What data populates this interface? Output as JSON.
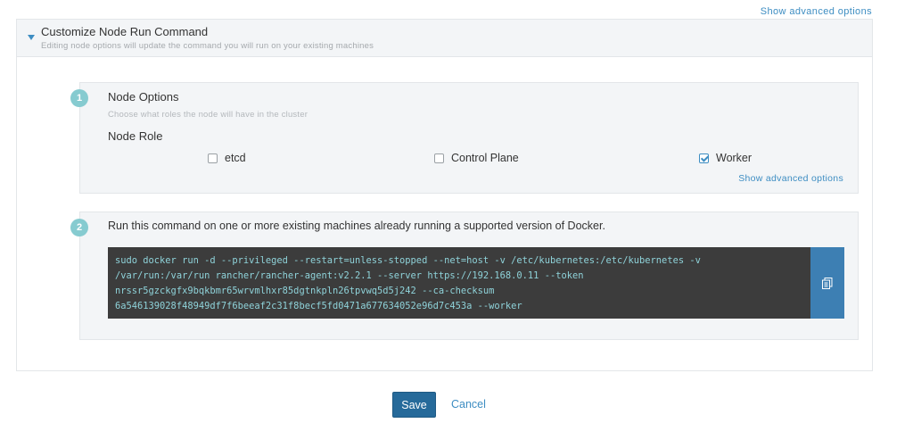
{
  "header": {
    "advanced_link": "Show advanced options"
  },
  "panel": {
    "title": "Customize Node Run Command",
    "subtitle": "Editing node options will update the command you will run on your existing machines"
  },
  "step1": {
    "number": "1",
    "title": "Node Options",
    "subtitle": "Choose what roles the node will have in the cluster",
    "role_label": "Node Role",
    "roles": [
      {
        "label": "etcd",
        "checked": false
      },
      {
        "label": "Control Plane",
        "checked": false
      },
      {
        "label": "Worker",
        "checked": true
      }
    ],
    "advanced_link": "Show advanced options"
  },
  "step2": {
    "number": "2",
    "intro": "Run this command on one or more existing machines already running a supported version of Docker.",
    "command_lines": [
      "sudo docker run -d --privileged --restart=unless-stopped --net=host -v /etc/kubernetes:/etc/kubernetes -v",
      "/var/run:/var/run rancher/rancher-agent:v2.2.1 --server https://192.168.0.11 --token",
      "nrssr5gzckgfx9bqkbmr65wrvmlhxr85dgtnkpln26tpvwq5d5j242 --ca-checksum",
      "6a546139028f48949df7f6beeaf2c31f8becf5fd0471a677634052e96d7c453a --worker"
    ],
    "copy_icon": "clipboard-icon"
  },
  "actions": {
    "save_label": "Save",
    "cancel_label": "Cancel"
  },
  "colors": {
    "accent": "#3d8dc2",
    "save_button": "#266a9a",
    "step_badge": "#86cbd0",
    "code_bg": "#3c3c3c",
    "code_text": "#8fd3da"
  }
}
